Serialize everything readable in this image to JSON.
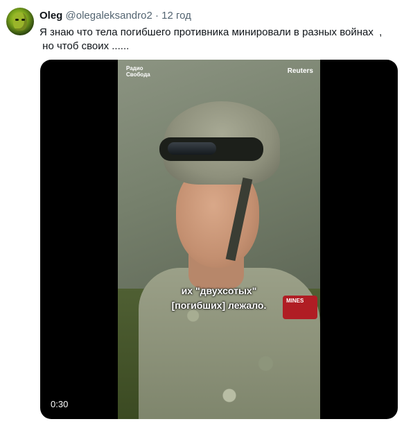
{
  "tweet": {
    "author_name": "Oleg",
    "author_handle": "@olegaleksandro2",
    "separator": "·",
    "time": "12 год",
    "text_lines": [
      "Я знаю что тела погибшего противника минировали в разных войнах  ,",
      " но чтоб своих ......"
    ]
  },
  "video": {
    "logo_left": "Радио Свобода",
    "logo_right": "Reuters",
    "subtitle_line1": "их \"двухсотых\"",
    "subtitle_line2": "[погибших] лежало.",
    "timer": "0:30",
    "patch_text": "MINES"
  },
  "colors": {
    "text": "#0f1419",
    "secondary_text": "#536471",
    "video_background": "#000000"
  }
}
